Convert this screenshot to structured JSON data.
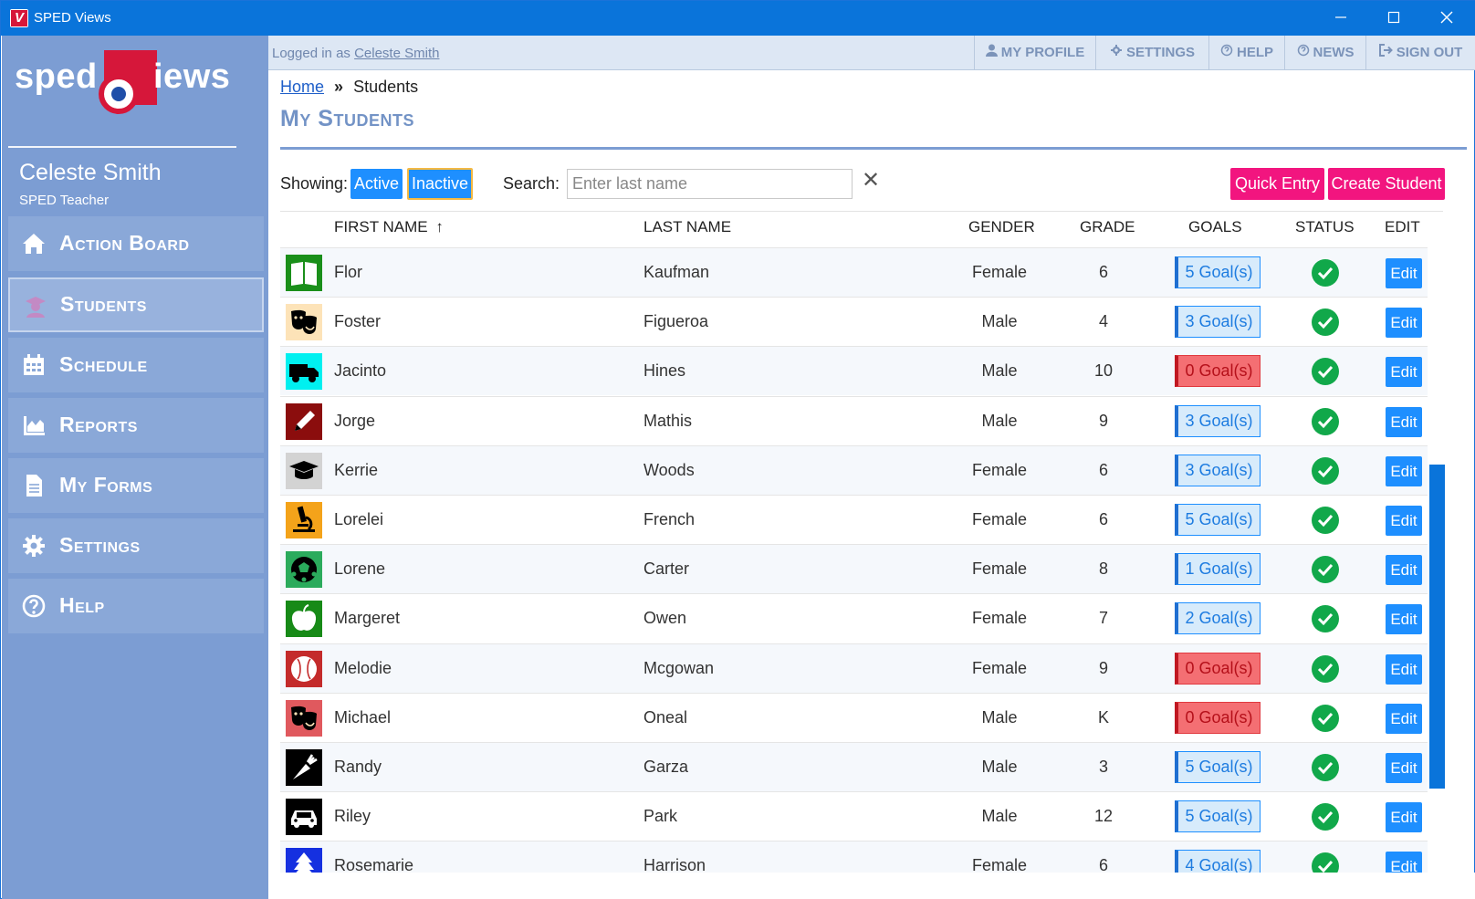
{
  "window": {
    "title": "SPED Views",
    "app_icon_letter": "V"
  },
  "logo": {
    "left_text": "sped",
    "right_text": "iews"
  },
  "user": {
    "name": "Celeste Smith",
    "role": "SPED Teacher"
  },
  "nav": [
    {
      "label": "Action Board",
      "icon": "home-icon"
    },
    {
      "label": "Students",
      "icon": "student-icon",
      "active": true
    },
    {
      "label": "Schedule",
      "icon": "calendar-icon"
    },
    {
      "label": "Reports",
      "icon": "chart-icon"
    },
    {
      "label": "My Forms",
      "icon": "document-icon"
    },
    {
      "label": "Settings",
      "icon": "gear-icon"
    },
    {
      "label": "Help",
      "icon": "help-icon"
    }
  ],
  "topbar": {
    "logged_prefix": "Logged in as",
    "logged_user": "Celeste Smith",
    "buttons": [
      "MY PROFILE",
      "SETTINGS",
      "HELP",
      "NEWS",
      "SIGN OUT"
    ]
  },
  "breadcrumb": {
    "home": "Home",
    "sep": "»",
    "current": "Students"
  },
  "page_title": "My Students",
  "filters": {
    "showing_label": "Showing:",
    "active_label": "Active",
    "inactive_label": "Inactive",
    "search_label": "Search:",
    "search_placeholder": "Enter last name",
    "clear_symbol": "✕"
  },
  "actions": {
    "quick_entry": "Quick Entry",
    "create_student": "Create Student"
  },
  "table": {
    "headers": {
      "first_name": "FIRST NAME",
      "last_name": "LAST NAME",
      "gender": "GENDER",
      "grade": "GRADE",
      "goals": "GOALS",
      "status": "STATUS",
      "edit": "EDIT"
    },
    "sort_indicator": "↑",
    "edit_label": "Edit",
    "rows": [
      {
        "first": "Flor",
        "last": "Kaufman",
        "gender": "Female",
        "grade": "6",
        "goals": "5 Goal(s)",
        "goals_zero": false,
        "avatar": "book-icon",
        "avatar_bg": "#1a8f1a"
      },
      {
        "first": "Foster",
        "last": "Figueroa",
        "gender": "Male",
        "grade": "4",
        "goals": "3 Goal(s)",
        "goals_zero": false,
        "avatar": "theater-masks-icon",
        "avatar_bg": "#fde3b8"
      },
      {
        "first": "Jacinto",
        "last": "Hines",
        "gender": "Male",
        "grade": "10",
        "goals": "0 Goal(s)",
        "goals_zero": true,
        "avatar": "truck-icon",
        "avatar_bg": "#00f0f0"
      },
      {
        "first": "Jorge",
        "last": "Mathis",
        "gender": "Male",
        "grade": "9",
        "goals": "3 Goal(s)",
        "goals_zero": false,
        "avatar": "pencil-icon",
        "avatar_bg": "#8b0d0d"
      },
      {
        "first": "Kerrie",
        "last": "Woods",
        "gender": "Female",
        "grade": "6",
        "goals": "3 Goal(s)",
        "goals_zero": false,
        "avatar": "graduation-cap-icon",
        "avatar_bg": "#d3d3d3"
      },
      {
        "first": "Lorelei",
        "last": "French",
        "gender": "Female",
        "grade": "6",
        "goals": "5 Goal(s)",
        "goals_zero": false,
        "avatar": "microscope-icon",
        "avatar_bg": "#f4a31a"
      },
      {
        "first": "Lorene",
        "last": "Carter",
        "gender": "Female",
        "grade": "8",
        "goals": "1 Goal(s)",
        "goals_zero": false,
        "avatar": "soccer-ball-icon",
        "avatar_bg": "#2bab5c"
      },
      {
        "first": "Margeret",
        "last": "Owen",
        "gender": "Female",
        "grade": "7",
        "goals": "2 Goal(s)",
        "goals_zero": false,
        "avatar": "apple-icon",
        "avatar_bg": "#178a17"
      },
      {
        "first": "Melodie",
        "last": "Mcgowan",
        "gender": "Female",
        "grade": "9",
        "goals": "0 Goal(s)",
        "goals_zero": true,
        "avatar": "baseball-icon",
        "avatar_bg": "#c42b2b"
      },
      {
        "first": "Michael",
        "last": "Oneal",
        "gender": "Male",
        "grade": "K",
        "goals": "0 Goal(s)",
        "goals_zero": true,
        "avatar": "theater-masks-icon",
        "avatar_bg": "#e0595e"
      },
      {
        "first": "Randy",
        "last": "Garza",
        "gender": "Male",
        "grade": "3",
        "goals": "5 Goal(s)",
        "goals_zero": false,
        "avatar": "carrot-icon",
        "avatar_bg": "#000000"
      },
      {
        "first": "Riley",
        "last": "Park",
        "gender": "Male",
        "grade": "12",
        "goals": "5 Goal(s)",
        "goals_zero": false,
        "avatar": "car-icon",
        "avatar_bg": "#000000"
      },
      {
        "first": "Rosemarie",
        "last": "Harrison",
        "gender": "Female",
        "grade": "6",
        "goals": "4 Goal(s)",
        "goals_zero": false,
        "avatar": "tree-icon",
        "avatar_bg": "#1530e0"
      }
    ]
  },
  "colors": {
    "accent": "#1e8fff",
    "pink": "#f2157f",
    "sidebar": "#7c9dd3",
    "titlebar": "#0a74da",
    "status_ok": "#11a84a",
    "goals_zero": "#f46f73"
  }
}
